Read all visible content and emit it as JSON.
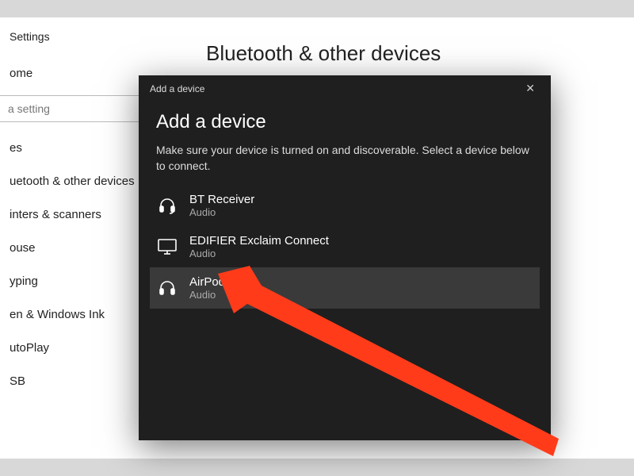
{
  "sidebar": {
    "header": "Settings",
    "search_placeholder": "a setting",
    "items": [
      {
        "label": "ome"
      },
      {
        "label": "es"
      },
      {
        "label": "uetooth & other devices"
      },
      {
        "label": "inters & scanners"
      },
      {
        "label": "ouse"
      },
      {
        "label": "yping"
      },
      {
        "label": "en & Windows Ink"
      },
      {
        "label": "utoPlay"
      },
      {
        "label": "SB"
      }
    ]
  },
  "page": {
    "title": "Bluetooth & other devices"
  },
  "dialog": {
    "titlebar": "Add a device",
    "heading": "Add a device",
    "subtext": "Make sure your device is turned on and discoverable. Select a device below to connect.",
    "devices": [
      {
        "name": "BT Receiver",
        "type": "Audio",
        "icon": "headset-icon"
      },
      {
        "name": "EDIFIER Exclaim Connect",
        "type": "Audio",
        "icon": "monitor-icon"
      },
      {
        "name": "AirPods",
        "type": "Audio",
        "icon": "headphones-icon"
      }
    ]
  },
  "colors": {
    "annotation": "#ff3b1a"
  }
}
